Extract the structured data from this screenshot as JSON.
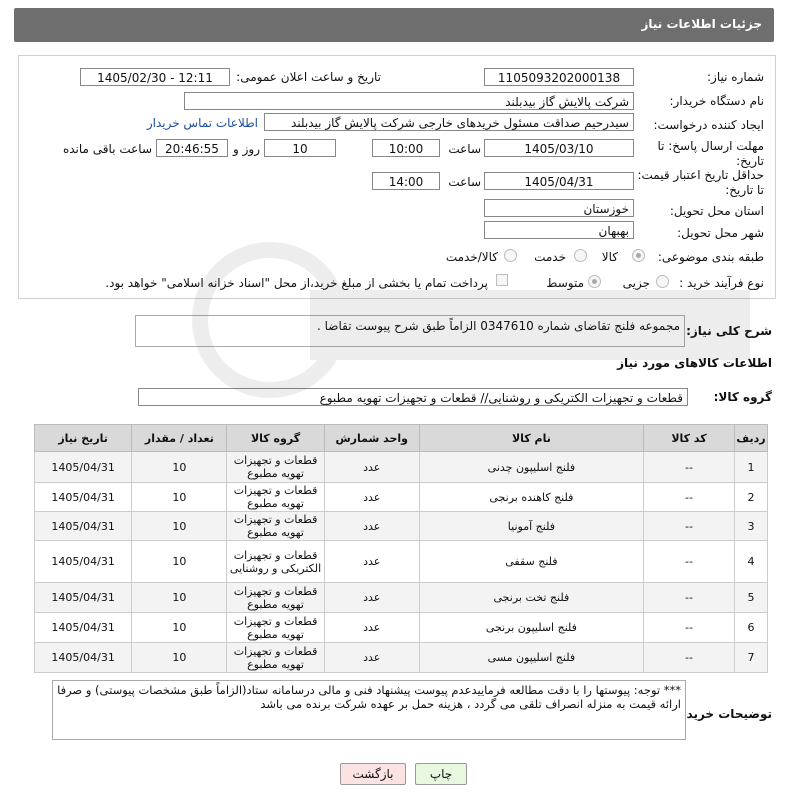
{
  "header": {
    "title": "جزئیات اطلاعات نیاز"
  },
  "form": {
    "need_number_label": "شماره نیاز:",
    "need_number": "1105093202000138",
    "announce_label": "تاریخ و ساعت اعلان عمومی:",
    "announce_value": "1405/02/30 - 12:11",
    "buyer_org_label": "نام دستگاه خریدار:",
    "buyer_org": "شرکت پالایش گاز بیدبلند",
    "requester_label": "ایجاد کننده درخواست:",
    "requester": "سیدرحیم صداقت مسئول خریدهای خارجی شرکت پالایش گاز بیدبلند",
    "contact_link": "اطلاعات تماس خریدار",
    "reply_deadline_label": "مهلت ارسال پاسخ: تا تاریخ:",
    "reply_date": "1405/03/10",
    "time_label": "ساعت",
    "reply_time": "10:00",
    "days_value": "10",
    "days_label": "روز و",
    "remaining_time": "20:46:55",
    "remaining_label": "ساعت باقی مانده",
    "price_validity_label": "حداقل تاریخ اعتبار قیمت: تا تاریخ:",
    "price_date": "1405/04/31",
    "price_time": "14:00",
    "province_label": "استان محل تحویل:",
    "province": "خوزستان",
    "city_label": "شهر محل تحویل:",
    "city": "بهبهان",
    "category_label": "طبقه بندی موضوعی:",
    "category_goods": "کالا",
    "category_service": "خدمت",
    "category_both": "کالا/خدمت",
    "process_label": "نوع فرآیند خرید :",
    "process_partial": "جزیی",
    "process_medium": "متوسط",
    "payment_note": "پرداخت تمام یا بخشی از مبلغ خرید،از محل \"اسناد خزانه اسلامی\" خواهد بود."
  },
  "description": {
    "label": "شرح کلی نیاز:",
    "text": "مجموعه فلنج تقاضای شماره 0347610 الزاماً طبق شرح پیوست تقاضا ."
  },
  "items_section": {
    "title": "اطلاعات کالاهای مورد نیاز",
    "group_label": "گروه کالا:",
    "group_value": "قطعات و تجهیزات الکتریکی و روشنایی//  قطعات و تجهیزات تهویه مطبوع"
  },
  "table": {
    "headers": [
      "ردیف",
      "کد کالا",
      "نام کالا",
      "واحد شمارش",
      "گروه کالا",
      "تعداد / مقدار",
      "تاریخ نیاز"
    ],
    "rows": [
      [
        "1",
        "--",
        "فلنج اسلیپون چدنی",
        "عدد",
        "قطعات و تجهیزات تهویه مطبوع",
        "10",
        "1405/04/31"
      ],
      [
        "2",
        "--",
        "فلنج کاهنده برنجی",
        "عدد",
        "قطعات و تجهیزات تهویه مطبوع",
        "10",
        "1405/04/31"
      ],
      [
        "3",
        "--",
        "فلنج آمونیا",
        "عدد",
        "قطعات و تجهیزات تهویه مطبوع",
        "10",
        "1405/04/31"
      ],
      [
        "4",
        "--",
        "فلنج سقفی",
        "عدد",
        "قطعات و تجهیزات الکتریکی و روشنایی",
        "10",
        "1405/04/31"
      ],
      [
        "5",
        "--",
        "فلنج تخت برنجی",
        "عدد",
        "قطعات و تجهیزات تهویه مطبوع",
        "10",
        "1405/04/31"
      ],
      [
        "6",
        "--",
        "فلنج اسلیپون برنجی",
        "عدد",
        "قطعات و تجهیزات تهویه مطبوع",
        "10",
        "1405/04/31"
      ],
      [
        "7",
        "--",
        "فلنج اسلیپون مسی",
        "عدد",
        "قطعات و تجهیزات تهویه مطبوع",
        "10",
        "1405/04/31"
      ]
    ]
  },
  "buyer_notes": {
    "label": "توضیحات خریدار:",
    "text": "***  توجه: پیوستها را با دقت مطالعه فرماییدعدم پیوست پیشنهاد فنی و مالی درسامانه ستاد(الزاماً طبق مشخصات پیوستی) و صرفا ارائه قیمت به منزله انصراف تلقی می گردد ، هزینه حمل بر عهده شرکت برنده می باشد"
  },
  "buttons": {
    "print": "چاپ",
    "back": "بازگشت"
  },
  "colors": {
    "header_bg": "#6e6e6e",
    "table_header_bg": "#d9d9d9",
    "link": "#1a4fa0",
    "print_btn": "#e8f8e0",
    "back_btn": "#fbe3e3"
  }
}
